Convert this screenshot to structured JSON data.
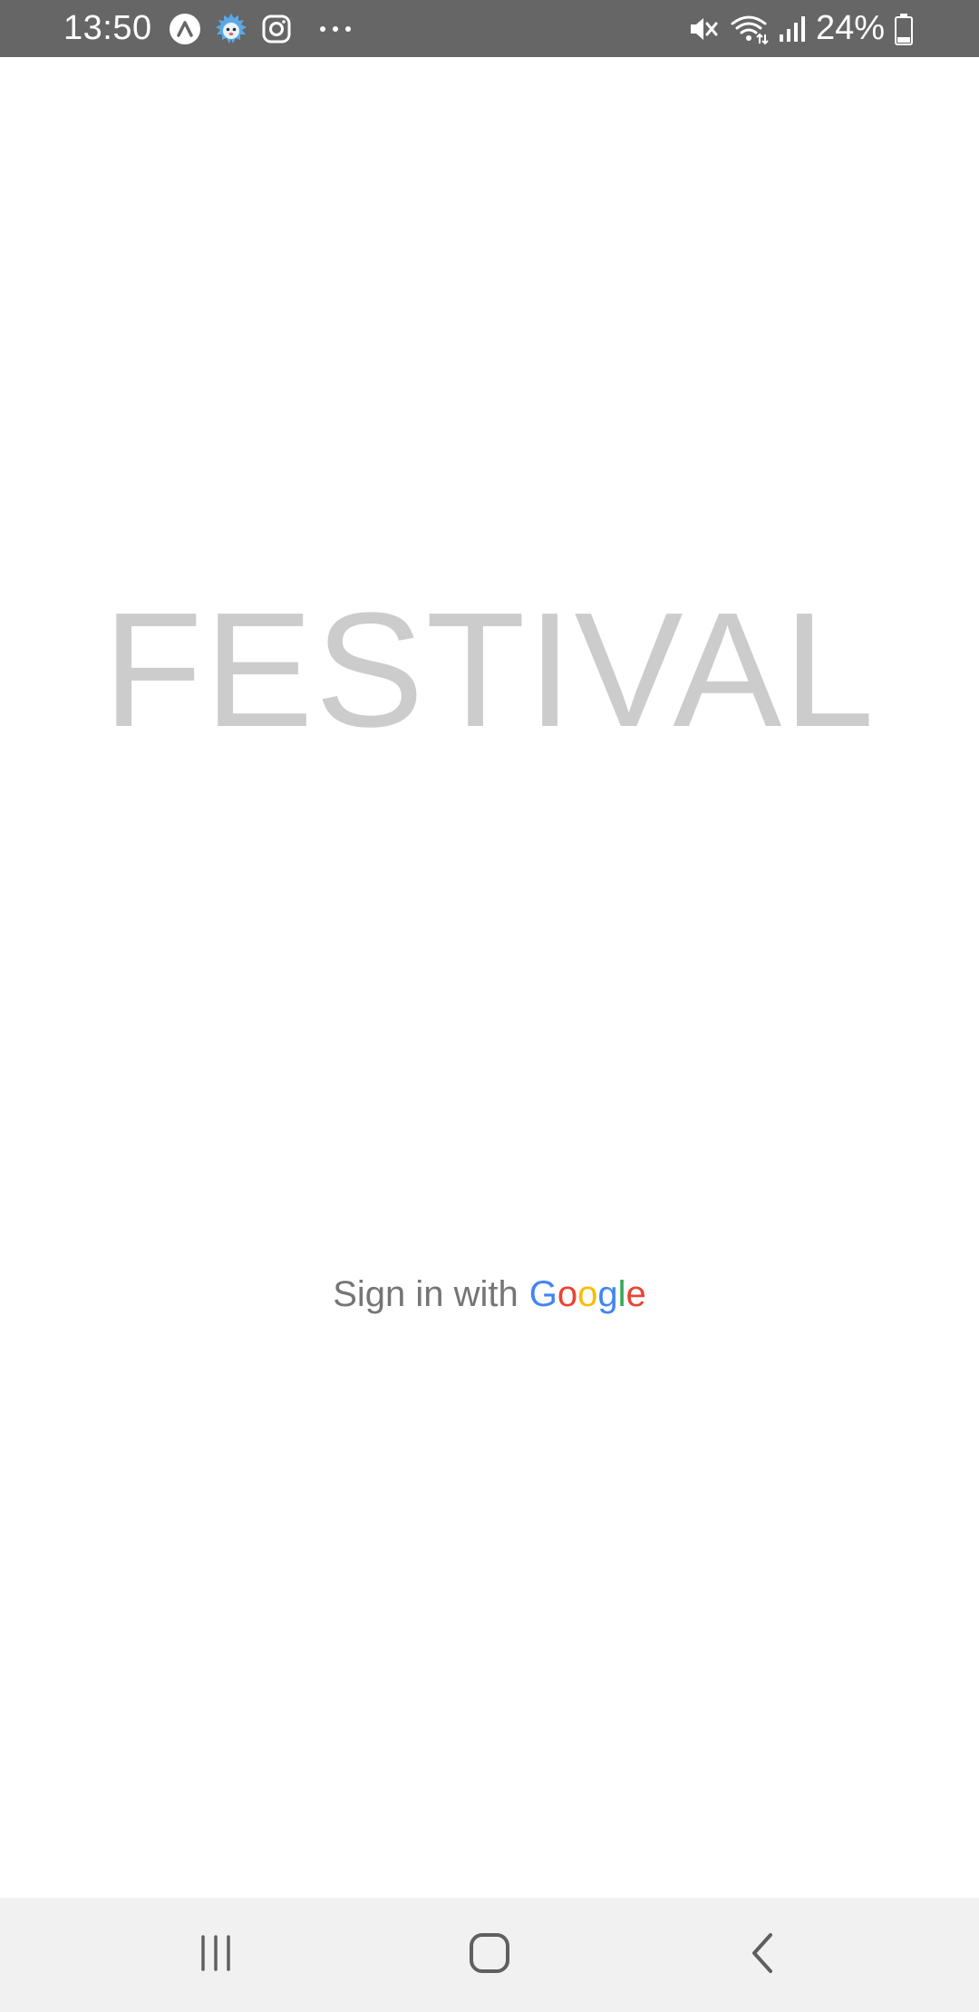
{
  "status_bar": {
    "time": "13:50",
    "battery_percent": "24%",
    "left_icons": [
      "app-a-icon",
      "mascot-app-icon",
      "instagram-icon",
      "more-dots-icon"
    ],
    "right_icons": [
      "mute-icon",
      "wifi-icon",
      "signal-icon",
      "battery-icon"
    ]
  },
  "app": {
    "title": "FESTIVAL"
  },
  "signin": {
    "prefix": "Sign in with",
    "brand_letters": [
      {
        "char": "G",
        "color": "#4285F4"
      },
      {
        "char": "o",
        "color": "#EA4335"
      },
      {
        "char": "o",
        "color": "#FBBC05"
      },
      {
        "char": "g",
        "color": "#4285F4"
      },
      {
        "char": "l",
        "color": "#34A853"
      },
      {
        "char": "e",
        "color": "#EA4335"
      }
    ]
  },
  "nav_bar": {
    "buttons": [
      "recents-icon",
      "home-icon",
      "back-icon"
    ]
  },
  "colors": {
    "status_bar_bg": "#666666",
    "title_color": "#cccccc",
    "signin_text": "#757575",
    "nav_bar_bg": "#f1f1f1"
  }
}
